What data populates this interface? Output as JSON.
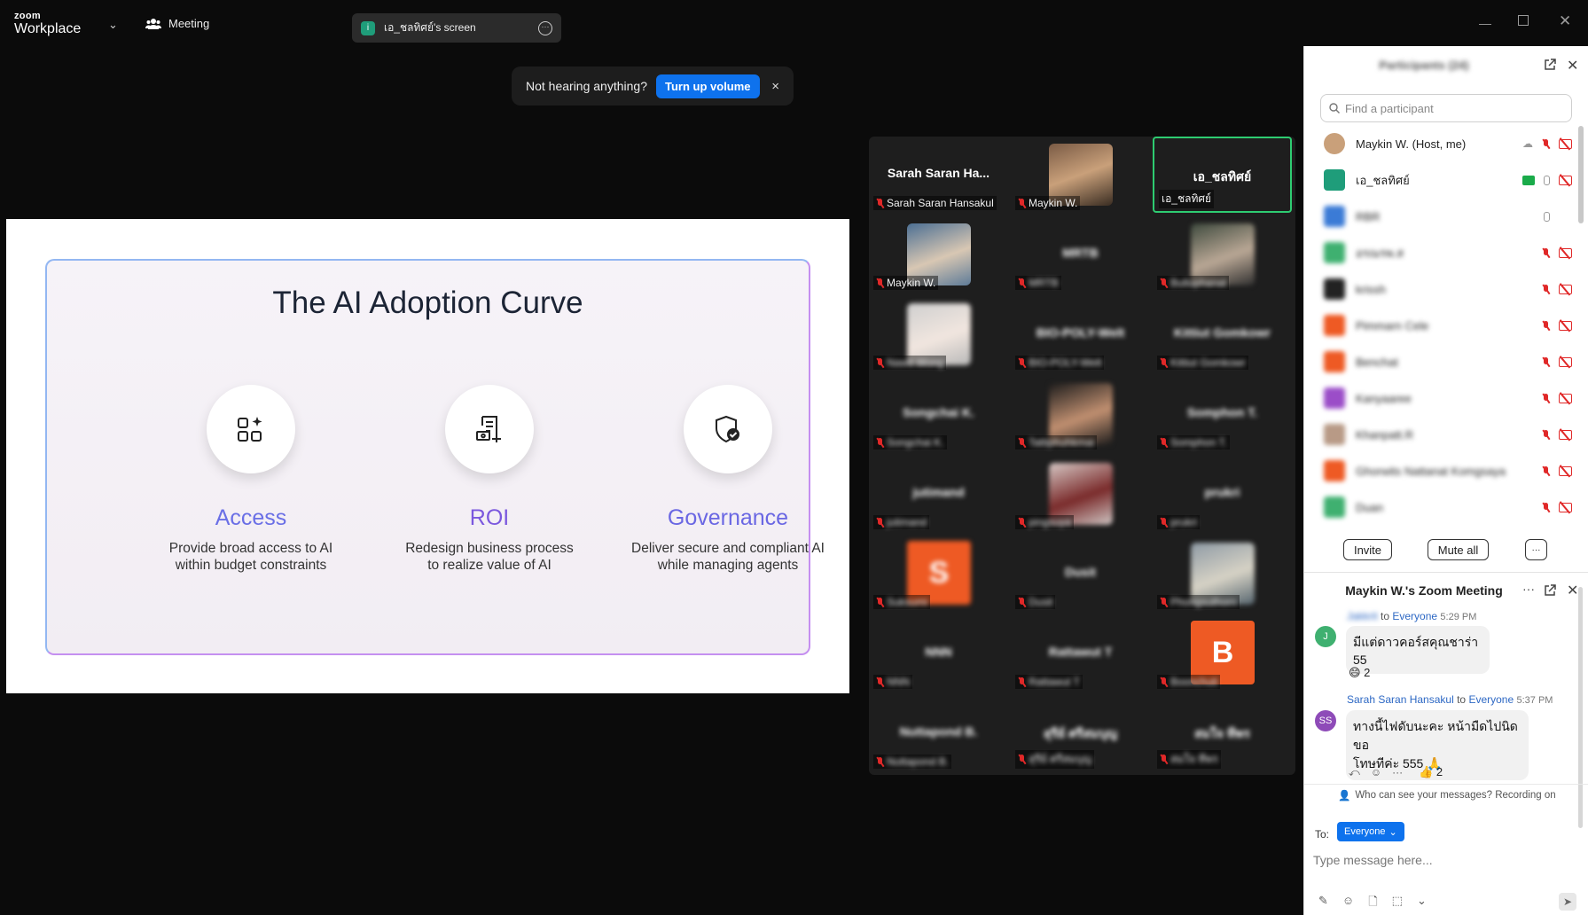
{
  "app": {
    "logo_top": "zoom",
    "logo_bottom": "Workplace",
    "meeting_label": "Meeting",
    "share_pill_badge": "i",
    "share_pill_label": "เอ_ชลทิศย์'s screen"
  },
  "notice": {
    "text": "Not hearing anything?",
    "button": "Turn up volume",
    "close": "×"
  },
  "slide": {
    "title": "The AI Adoption Curve",
    "columns": [
      {
        "heading": "Access",
        "line1": "Provide broad access to AI",
        "line2": "within budget constraints",
        "color": "#5b6ee8"
      },
      {
        "heading": "ROI",
        "line1": "Redesign business process",
        "line2": "to realize value of AI",
        "color": "#7a5fe0"
      },
      {
        "heading": "Governance",
        "line1": "Deliver secure and compliant AI",
        "line2": "while managing agents",
        "color": "#6f6ae8"
      }
    ]
  },
  "gallery": {
    "tiles": [
      {
        "name": "Sarah Saran Ha...",
        "label": "Sarah Saran Hansakul"
      },
      {
        "name": "",
        "label": "Maykin W."
      },
      {
        "name": "เอ_ชลทิศย์",
        "label": "เอ_ชลทิศย์"
      },
      {
        "name": "",
        "label": "Maykin W."
      },
      {
        "name": "MRTB",
        "label": "MRTB"
      },
      {
        "name": "",
        "label": "Bulluphanat"
      },
      {
        "name": "",
        "label": "Nawit Wong"
      },
      {
        "name": "BIO-POLY-Welt",
        "label": "BIO-POLY-Welt"
      },
      {
        "name": "Kittiut Gomkowr",
        "label": "Kittiut Gomkowr"
      },
      {
        "name": "Songchai K.",
        "label": "Songchai K."
      },
      {
        "name": "",
        "label": "Tattiphuhkmai"
      },
      {
        "name": "Somphon T.",
        "label": "Somphon T."
      },
      {
        "name": "jutimand",
        "label": "jutimand"
      },
      {
        "name": "",
        "label": "pingsuya"
      },
      {
        "name": "prukri",
        "label": "prukri"
      },
      {
        "name": "S",
        "label": "Suksumi"
      },
      {
        "name": "Dusit",
        "label": "Dusit"
      },
      {
        "name": "",
        "label": "Phongsuthorn"
      },
      {
        "name": "NNN",
        "label": "NNN"
      },
      {
        "name": "Rattawut T",
        "label": "Rattawut T"
      },
      {
        "name": "B",
        "label": "Boonchuti"
      },
      {
        "name": "Nuttapond B.",
        "label": "Nuttapond B."
      },
      {
        "name": "สุรีย์ ศรีสมบุญ",
        "label": "สุรีย์ ศรีสมบุญ"
      },
      {
        "name": "สมใจ ทีพร",
        "label": "สมใจ ทีพร"
      }
    ]
  },
  "participants": {
    "title": "Participants (24)",
    "search_placeholder": "Find a participant",
    "rows": [
      {
        "name": "Maykin W. (Host, me)",
        "color": "#c9a07a"
      },
      {
        "name": "เอ_ชลทิศย์",
        "color": "#1f9d7a"
      },
      {
        "name": "RBR",
        "color": "#3b7bd6"
      },
      {
        "name": "อรณรพ.ส",
        "color": "#3fb070"
      },
      {
        "name": "krissh",
        "color": "#222222"
      },
      {
        "name": "Pimmarn Cele",
        "color": "#ee5a24"
      },
      {
        "name": "Benchat",
        "color": "#ee5a24"
      },
      {
        "name": "Kanyaaree",
        "color": "#9b4dc8"
      },
      {
        "name": "Khanpatt.R",
        "color": "#b89a86"
      },
      {
        "name": "Ghorwits Nattanat Komgsaya",
        "color": "#ee5a24"
      },
      {
        "name": "Duan",
        "color": "#3fb070"
      }
    ],
    "invite": "Invite",
    "mute_all": "Mute all",
    "more": "···"
  },
  "chat": {
    "title": "Maykin W.'s Zoom Meeting",
    "messages": [
      {
        "avatar": "J",
        "avatar_color": "#3fb070",
        "sender": "Jakkrit",
        "to": "to",
        "audience": "Everyone",
        "time": "5:29 PM",
        "text": "มีแต่ดาวคอร์สคุณชาร่า 55",
        "reaction": "😄 2"
      },
      {
        "avatar": "SS",
        "avatar_color": "#8e4bb8",
        "sender": "Sarah Saran Hansakul",
        "to": "to",
        "audience": "Everyone",
        "time": "5:37 PM",
        "text1": "ทางนี้ไฟดับนะคะ หน้ามืดไปนิด ขอ",
        "text2": "โทษทีค่ะ 555 🙏",
        "reaction": "👍 2"
      }
    ],
    "privacy": "Who can see your messages? Recording on",
    "to_label": "To:",
    "to_value": "Everyone",
    "input_placeholder": "Type message here..."
  }
}
